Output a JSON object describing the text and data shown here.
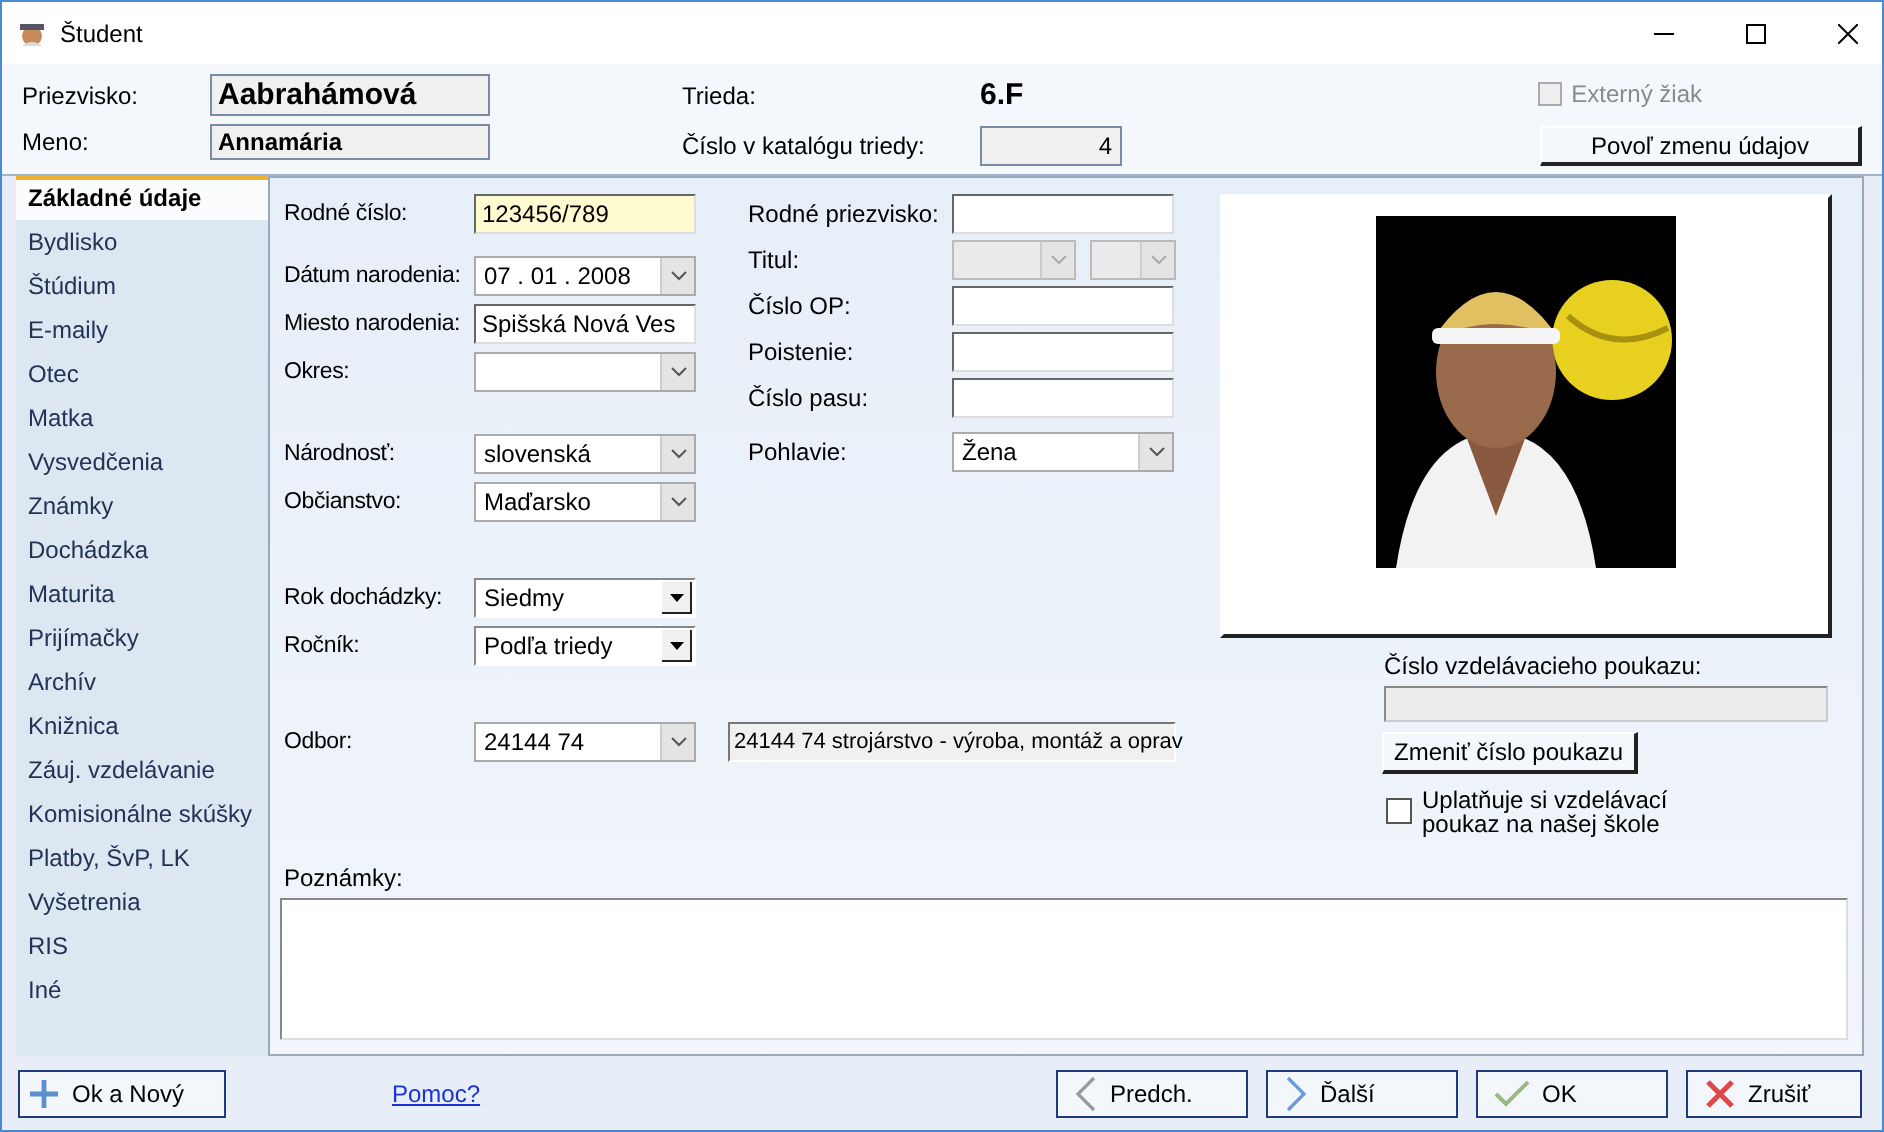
{
  "window": {
    "title": "Študent"
  },
  "header": {
    "names": [
      {
        "label": "Priezvisko:",
        "value": "Aabrahámová"
      },
      {
        "label": "Meno:",
        "value": "Annamária"
      }
    ],
    "class": {
      "label": "Trieda:",
      "value": "6.F"
    },
    "catalog": {
      "label": "Číslo v katalógu triedy:",
      "value": "4"
    },
    "external": {
      "label": "Externý žiak",
      "checked": false,
      "disabled": true
    },
    "unlock_button": "Povoľ zmenu údajov"
  },
  "sidebar": {
    "items": [
      {
        "label": "Základné údaje",
        "selected": true
      },
      {
        "label": "Bydlisko",
        "selected": false
      },
      {
        "label": "Štúdium",
        "selected": false
      },
      {
        "label": "E-maily",
        "selected": false
      },
      {
        "label": "Otec",
        "selected": false
      },
      {
        "label": "Matka",
        "selected": false
      },
      {
        "label": "Vysvedčenia",
        "selected": false
      },
      {
        "label": "Známky",
        "selected": false
      },
      {
        "label": "Dochádzka",
        "selected": false
      },
      {
        "label": "Maturita",
        "selected": false
      },
      {
        "label": "Prijímačky",
        "selected": false
      },
      {
        "label": "Archív",
        "selected": false
      },
      {
        "label": "Knižnica",
        "selected": false
      },
      {
        "label": "Záuj. vzdelávanie",
        "selected": false
      },
      {
        "label": "Komisionálne skúšky",
        "selected": false
      },
      {
        "label": "Platby, ŠvP, LK",
        "selected": false
      },
      {
        "label": "Vyšetrenia",
        "selected": false
      },
      {
        "label": "RIS",
        "selected": false
      },
      {
        "label": "Iné",
        "selected": false
      }
    ]
  },
  "form": {
    "left_groups": [
      [
        {
          "kind": "text",
          "label": "Rodné číslo:",
          "value": "123456/789",
          "highlighted": true
        }
      ],
      [
        {
          "kind": "date",
          "label": "Dátum narodenia:",
          "value": "07 . 01 . 2008"
        },
        {
          "kind": "text",
          "label": "Miesto narodenia:",
          "value": "Spišská Nová Ves",
          "highlighted": false
        },
        {
          "kind": "combo",
          "label": "Okres:"
        }
      ],
      [
        {
          "kind": "combo",
          "label": "Národnosť:",
          "value": "slovenská"
        },
        {
          "kind": "combo",
          "label": "Občianstvo:",
          "value": "Maďarsko"
        }
      ],
      [
        {
          "kind": "dropdown",
          "label": "Rok dochádzky:",
          "value": "Siedmy"
        },
        {
          "kind": "dropdown",
          "label": "Ročník:",
          "value": "Podľa triedy"
        }
      ]
    ],
    "right_fields": [
      {
        "kind": "text",
        "label": "Rodné priezvisko:",
        "highlighted": false
      },
      {
        "kind": "combo_pair",
        "label": "Titul:",
        "disabled": true
      },
      {
        "kind": "text",
        "label": "Číslo OP:",
        "highlighted": false
      },
      {
        "kind": "text",
        "label": "Poistenie:",
        "highlighted": false
      },
      {
        "kind": "text",
        "label": "Číslo pasu:",
        "highlighted": false
      },
      {
        "kind": "combo",
        "label": "Pohlavie:",
        "value": "Žena"
      }
    ],
    "study_field": {
      "label": "Odbor:",
      "code": "24144 74",
      "name": "24144 74 strojárstvo - výroba, montáž a oprav"
    },
    "notes": {
      "label": "Poznámky:"
    }
  },
  "voucher": {
    "label": "Číslo vzdelávacieho poukazu:",
    "button": "Zmeniť číslo poukazu",
    "claim": {
      "label": "Uplatňuje si vzdelávací poukaz na našej škole",
      "checked": false
    }
  },
  "footer": {
    "buttons": [
      {
        "kind": "new",
        "label": "Ok a Nový"
      },
      {
        "kind": "prev",
        "label": "Predch."
      },
      {
        "kind": "next",
        "label": "Ďalší"
      },
      {
        "kind": "ok",
        "label": "OK"
      },
      {
        "kind": "cancel",
        "label": "Zrušiť"
      }
    ],
    "help_link": "Pomoc?"
  }
}
